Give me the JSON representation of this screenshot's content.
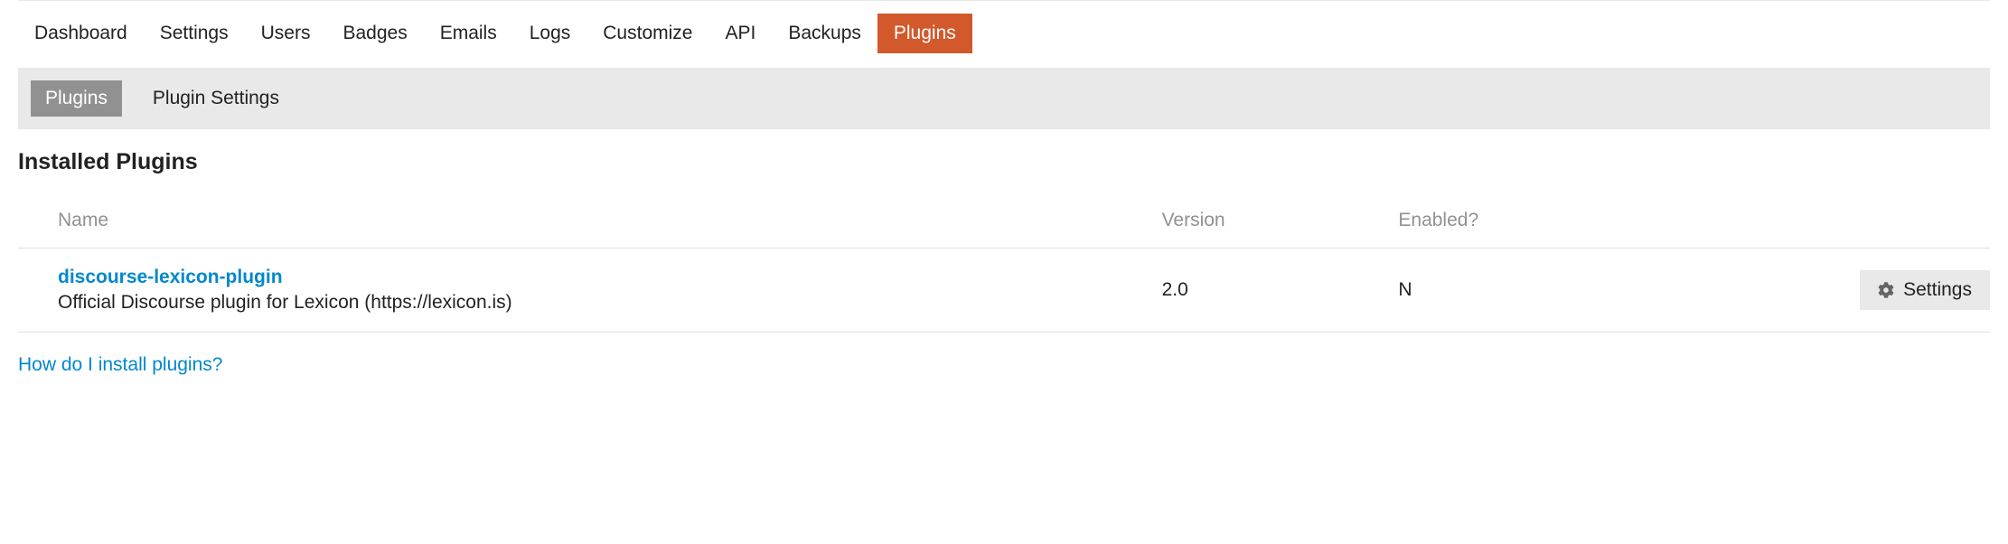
{
  "nav": {
    "items": [
      {
        "label": "Dashboard"
      },
      {
        "label": "Settings"
      },
      {
        "label": "Users"
      },
      {
        "label": "Badges"
      },
      {
        "label": "Emails"
      },
      {
        "label": "Logs"
      },
      {
        "label": "Customize"
      },
      {
        "label": "API"
      },
      {
        "label": "Backups"
      },
      {
        "label": "Plugins"
      }
    ],
    "active_index": 9
  },
  "subnav": {
    "items": [
      {
        "label": "Plugins"
      },
      {
        "label": "Plugin Settings"
      }
    ],
    "active_index": 0
  },
  "heading": "Installed Plugins",
  "table": {
    "headers": {
      "name": "Name",
      "version": "Version",
      "enabled": "Enabled?"
    },
    "rows": [
      {
        "name": "discourse-lexicon-plugin",
        "description": "Official Discourse plugin for Lexicon (https://lexicon.is)",
        "version": "2.0",
        "enabled": "N",
        "action_label": "Settings"
      }
    ]
  },
  "help_link": "How do I install plugins?"
}
